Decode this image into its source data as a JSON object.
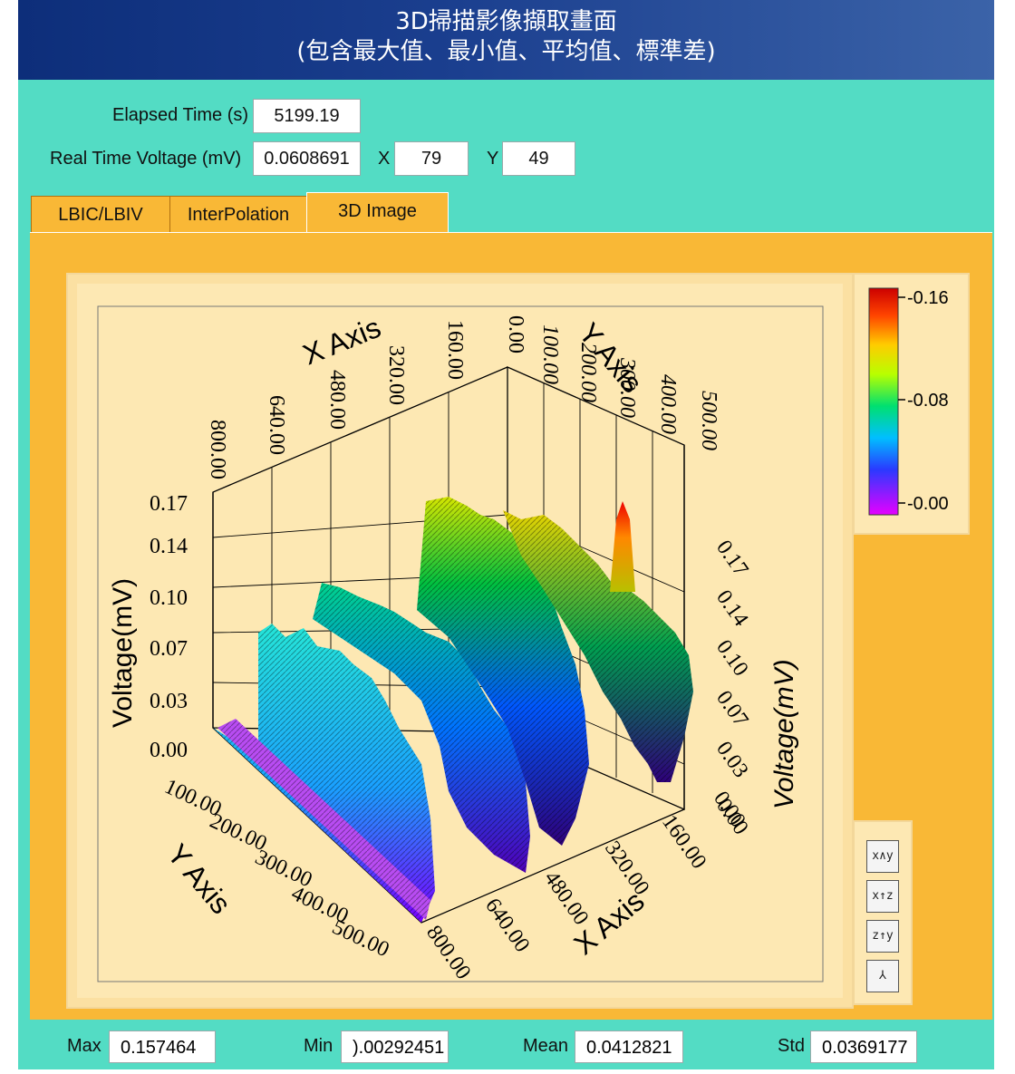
{
  "title": {
    "line1": "3D掃描影像擷取畫面",
    "line2": "(包含最大值、最小值、平均值、標準差)"
  },
  "status": {
    "elapsed_label": "Elapsed Time (s)",
    "elapsed_value": "5199.19",
    "voltage_label": "Real Time Voltage (mV)",
    "voltage_value": "0.0608691",
    "x_label": "X",
    "x_value": "79",
    "y_label": "Y",
    "y_value": "49"
  },
  "tabs": [
    "LBIC/LBIV",
    "InterPolation",
    "3D Image"
  ],
  "active_tab": "3D Image",
  "graph": {
    "x_axis_title": "X Axis",
    "y_axis_title": "Y Axis",
    "z_axis_title": "Voltage(mV)",
    "x_ticks": [
      "0.00",
      "160.00",
      "320.00",
      "480.00",
      "640.00",
      "800.00"
    ],
    "y_ticks": [
      "0.00",
      "100.00",
      "200.00",
      "300.00",
      "400.00",
      "500.00"
    ],
    "z_ticks": [
      "0.00",
      "0.03",
      "0.07",
      "0.10",
      "0.14",
      "0.17"
    ],
    "colors": {
      "high": "#ff0000",
      "mid": "#00ff00",
      "low": "#ff00ff"
    }
  },
  "legend": {
    "labels": [
      "-0.16",
      "-0.08",
      "-0.00"
    ]
  },
  "tools": [
    {
      "icon": "xy-plane-icon",
      "text": "x∧y"
    },
    {
      "icon": "xz-plane-icon",
      "text": "x↑z"
    },
    {
      "icon": "yz-plane-icon",
      "text": "z↑y"
    },
    {
      "icon": "3d-view-icon",
      "text": "⅄"
    }
  ],
  "stats": {
    "max_label": "Max",
    "max_value": "0.157464",
    "min_label": "Min",
    "min_value": ").00292451",
    "mean_label": "Mean",
    "mean_value": "0.0412821",
    "std_label": "Std",
    "std_value": "0.0369177"
  }
}
